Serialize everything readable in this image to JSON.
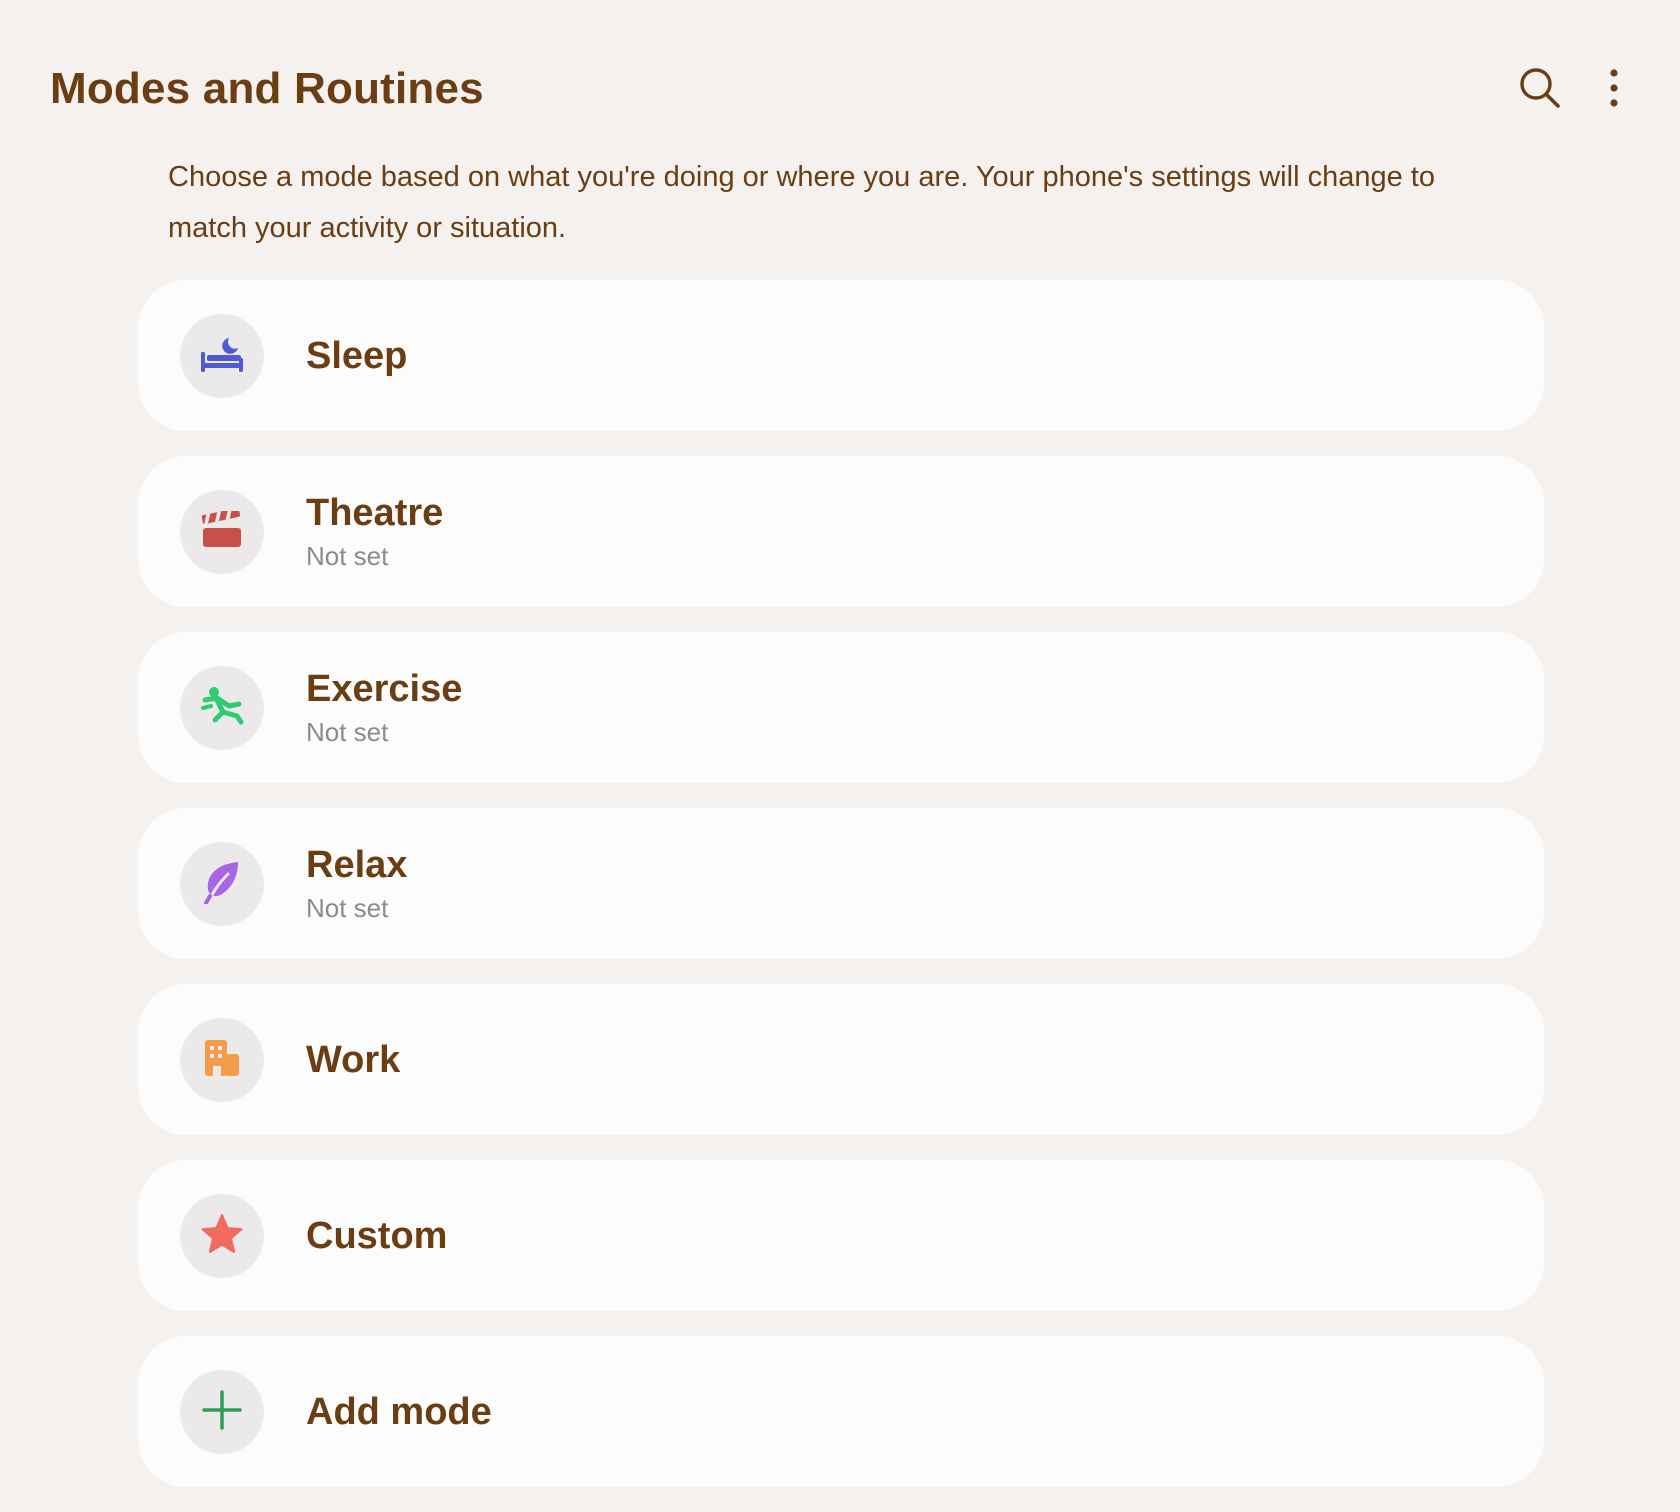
{
  "header": {
    "title": "Modes and Routines",
    "search_icon": "search-icon",
    "more_icon": "more-options-icon"
  },
  "description": "Choose a mode based on what you're doing or where you are. Your phone's settings will change to match your activity or situation.",
  "modes": [
    {
      "title": "Sleep",
      "subtitle": "",
      "icon": "bed-moon-icon",
      "color": "#4f5bd5"
    },
    {
      "title": "Theatre",
      "subtitle": "Not set",
      "icon": "clapperboard-icon",
      "color": "#c9504a"
    },
    {
      "title": "Exercise",
      "subtitle": "Not set",
      "icon": "running-person-icon",
      "color": "#2ecc71"
    },
    {
      "title": "Relax",
      "subtitle": "Not set",
      "icon": "leaf-icon",
      "color": "#a765e8"
    },
    {
      "title": "Work",
      "subtitle": "",
      "icon": "building-icon",
      "color": "#f39c4a"
    },
    {
      "title": "Custom",
      "subtitle": "",
      "icon": "star-icon",
      "color": "#f06a60"
    },
    {
      "title": "Add mode",
      "subtitle": "",
      "icon": "plus-icon",
      "color": "#2e9e55"
    }
  ]
}
